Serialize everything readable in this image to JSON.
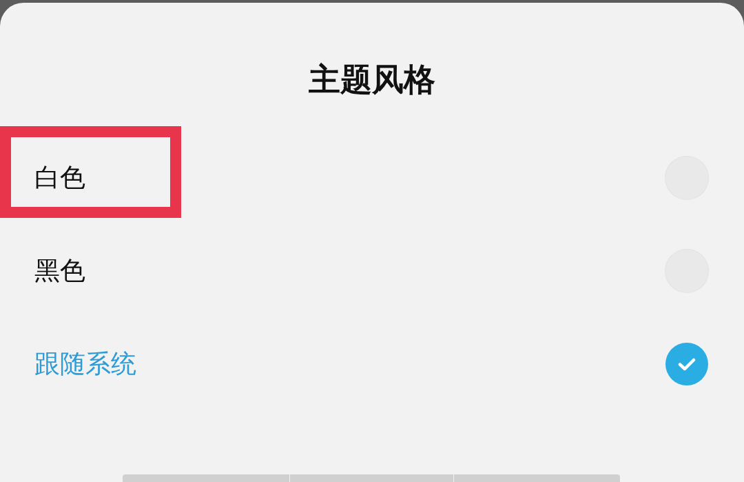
{
  "dialog": {
    "title": "主题风格",
    "options": [
      {
        "label": "白色",
        "selected": false,
        "highlighted": true
      },
      {
        "label": "黑色",
        "selected": false,
        "highlighted": false
      },
      {
        "label": "跟随系统",
        "selected": true,
        "highlighted": false
      }
    ]
  }
}
